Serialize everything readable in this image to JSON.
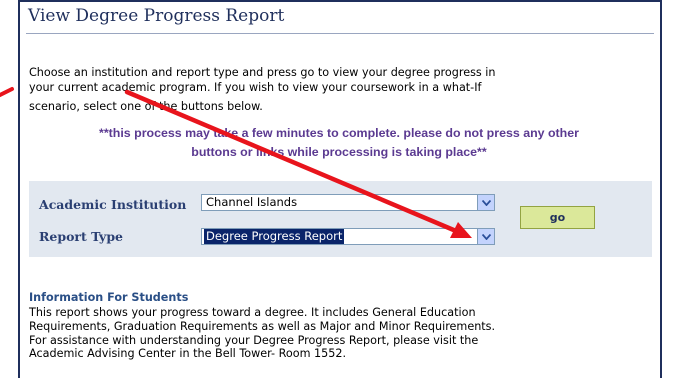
{
  "page": {
    "title": "View Degree Progress Report"
  },
  "intro": {
    "line1": "Choose an institution and report type and press go to view your degree progress in",
    "line2": "your current academic program. If you wish to view your coursework in a what-If",
    "line3": "scenario, select one of the buttons below."
  },
  "warning": {
    "line1": "**this process may take a few minutes to complete. please do not press any other",
    "line2": "buttons or links while processing is taking place**"
  },
  "form": {
    "institution_label": "Academic Institution",
    "institution_value": "Channel Islands",
    "report_type_label": "Report Type",
    "report_type_value": "Degree Progress Report",
    "go_label": "go"
  },
  "info": {
    "heading": "Information For Students",
    "line1": "This report shows your progress toward a degree. It includes General Education",
    "line2": "Requirements, Graduation Requirements as well as Major and Minor Requirements.",
    "line3": "For assistance with understanding your Degree Progress Report, please visit the",
    "line4": "Academic Advising Center in the Bell Tower- Room 1552."
  },
  "colors": {
    "accent": "#1f2f5c",
    "warning": "#5b3a91",
    "annotation_arrow": "#e8141c",
    "button": "#dbe89a"
  }
}
